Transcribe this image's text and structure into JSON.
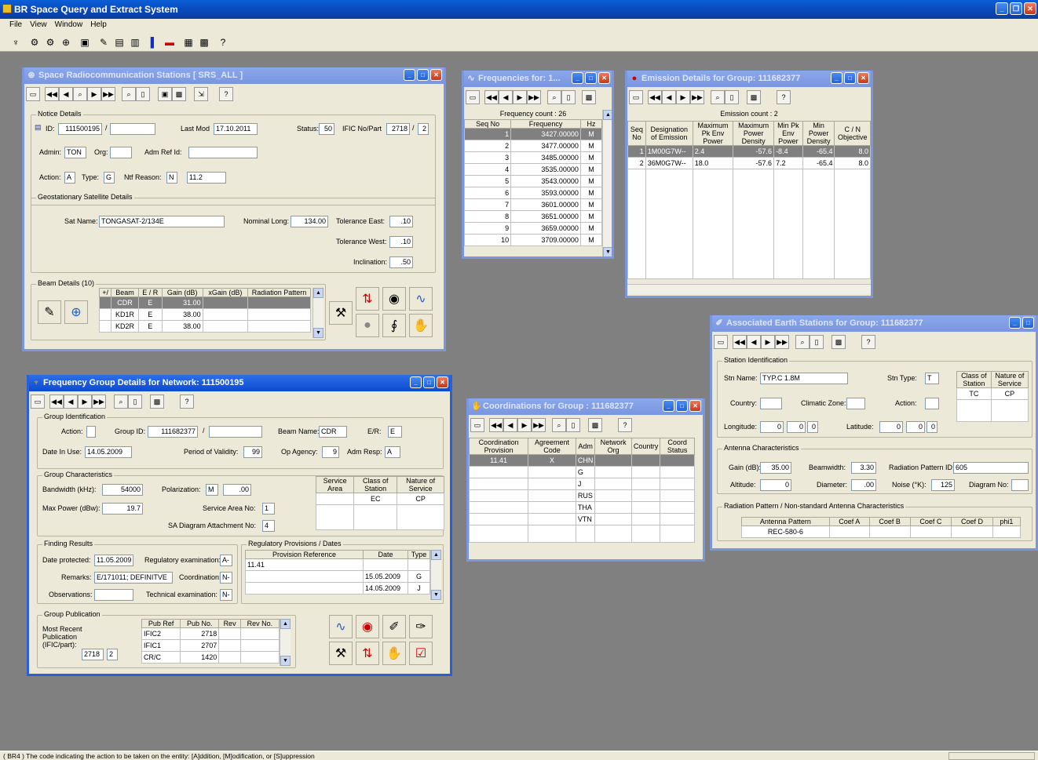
{
  "app": {
    "title": "BR Space Query and Extract System",
    "menus": [
      "File",
      "View",
      "Window",
      "Help"
    ]
  },
  "status": {
    "text": "( BR4 )  The code indicating the action to be taken on the entity: [A]ddition, [M]odification, or [S]uppression"
  },
  "srs": {
    "title": "Space Radiocommunication Stations    [ SRS_ALL ]",
    "notice": {
      "legend": "Notice Details",
      "id_label": "ID:",
      "id": "111500195",
      "lastmod_label": "Last Mod",
      "lastmod": "17.10.2011",
      "status_label": "Status:",
      "status": "50",
      "ific_label": "IFIC No/Part",
      "ific_no": "2718",
      "ific_part": "2",
      "admin_label": "Admin:",
      "admin": "TON",
      "org_label": "Org:",
      "admref_label": "Adm Ref Id:",
      "action_label": "Action:",
      "action": "A",
      "type_label": "Type:",
      "type": "G",
      "ntf_label": "Ntf Reason:",
      "ntf": "N",
      "ntf_val": "11.2"
    },
    "geo": {
      "legend": "Geostationary Satellite Details",
      "sat_label": "Sat Name:",
      "sat": "TONGASAT-2/134E",
      "long_label": "Nominal Long:",
      "long": "134.00",
      "tol_e_label": "Tolerance East:",
      "tol_e": ".10",
      "tol_w_label": "Tolerance West:",
      "tol_w": ".10",
      "incl_label": "Inclination:",
      "incl": ".50"
    },
    "beams": {
      "legend": "Beam Details (10)",
      "headers": [
        "+/",
        "Beam",
        "E / R",
        "Gain (dB)",
        "xGain (dB)",
        "Radiation Pattern"
      ],
      "rows": [
        [
          "",
          "CDR",
          "E",
          "31.00",
          "",
          ""
        ],
        [
          "",
          "KD1R",
          "E",
          "38.00",
          "",
          ""
        ],
        [
          "",
          "KD2R",
          "E",
          "38.00",
          "",
          ""
        ]
      ]
    }
  },
  "freqs": {
    "title": "Frequencies for: 1...",
    "count": "Frequency count : 26",
    "headers": [
      "Seq No",
      "Frequency",
      "Hz"
    ],
    "rows": [
      [
        "1",
        "3427.00000",
        "M"
      ],
      [
        "2",
        "3477.00000",
        "M"
      ],
      [
        "3",
        "3485.00000",
        "M"
      ],
      [
        "4",
        "3535.00000",
        "M"
      ],
      [
        "5",
        "3543.00000",
        "M"
      ],
      [
        "6",
        "3593.00000",
        "M"
      ],
      [
        "7",
        "3601.00000",
        "M"
      ],
      [
        "8",
        "3651.00000",
        "M"
      ],
      [
        "9",
        "3659.00000",
        "M"
      ],
      [
        "10",
        "3709.00000",
        "M"
      ]
    ]
  },
  "emis": {
    "title": "Emission Details for Group: 111682377",
    "count": "Emission count : 2",
    "headers": [
      "Seq No",
      "Designation of Emission",
      "Maximum Pk Env Power",
      "Maximum Power Density",
      "Min Pk Env Power",
      "Min Power Density",
      "C / N Objective"
    ],
    "rows": [
      [
        "1",
        "1M00G7W--",
        "2.4",
        "-57.6",
        "-8.4",
        "-65.4",
        "8.0"
      ],
      [
        "2",
        "36M0G7W--",
        "18.0",
        "-57.6",
        "7.2",
        "-65.4",
        "8.0"
      ]
    ]
  },
  "fgd": {
    "title": "Frequency Group Details for Network: 111500195",
    "gid": {
      "legend": "Group Identification",
      "action_label": "Action:",
      "gid_label": "Group ID:",
      "gid": "111682377",
      "beam_label": "Beam Name:",
      "beam": "CDR",
      "er_label": "E/R:",
      "er": "E",
      "date_label": "Date In Use:",
      "date": "14.05.2009",
      "period_label": "Period of Validity:",
      "period": "99",
      "op_label": "Op Agency:",
      "op": "9",
      "adm_label": "Adm Resp:",
      "adm": "A"
    },
    "gc": {
      "legend": "Group Characteristics",
      "bw_label": "Bandwidth (kHz):",
      "bw": "54000",
      "pol_label": "Polarization:",
      "pol": "M",
      "pol2": ".00",
      "mp_label": "Max Power (dBw):",
      "mp": "19.7",
      "sa_label": "Service Area No:",
      "sa": "1",
      "sad_label": "SA Diagram Attachment No:",
      "sad": "4",
      "cols": [
        "Service Area",
        "Class of Station",
        "Nature of Service"
      ],
      "row": [
        "",
        "EC",
        "CP"
      ]
    },
    "fr": {
      "legend": "Finding Results",
      "dp_label": "Date protected:",
      "dp": "11.05.2009",
      "reg_label": "Regulatory examination:",
      "reg": "A-",
      "rem_label": "Remarks:",
      "rem": "E/171011; DEFINITVE",
      "coord_label": "Coordination:",
      "coord": "N-",
      "obs_label": "Observations:",
      "tech_label": "Technical examination:",
      "tech": "N-"
    },
    "rp": {
      "legend": "Regulatory Provisions / Dates",
      "headers": [
        "Provision Reference",
        "Date",
        "Type"
      ],
      "rows": [
        [
          "11.41",
          "",
          ""
        ],
        [
          "",
          "15.05.2009",
          "G"
        ],
        [
          "",
          "14.05.2009",
          "J"
        ]
      ]
    },
    "gp": {
      "legend": "Group Publication",
      "most": "Most Recent Publication (IFIC/part):",
      "ific": "2718",
      "part": "2",
      "headers": [
        "Pub Ref",
        "Pub No.",
        "Rev",
        "Rev No."
      ],
      "rows": [
        [
          "IFIC2",
          "2718",
          "",
          ""
        ],
        [
          "IFIC1",
          "2707",
          "",
          ""
        ],
        [
          "CR/C",
          "1420",
          "",
          ""
        ]
      ]
    }
  },
  "coord": {
    "title": "Coordinations for Group : 111682377",
    "headers": [
      "Coordination Provision",
      "Agreement Code",
      "Adm",
      "Network Org",
      "Country",
      "Coord Status"
    ],
    "rows": [
      [
        "11.41",
        "X",
        "CHN",
        "",
        "",
        ""
      ],
      [
        "",
        "",
        "G",
        "",
        "",
        ""
      ],
      [
        "",
        "",
        "J",
        "",
        "",
        ""
      ],
      [
        "",
        "",
        "RUS",
        "",
        "",
        ""
      ],
      [
        "",
        "",
        "THA",
        "",
        "",
        ""
      ],
      [
        "",
        "",
        "VTN",
        "",
        "",
        ""
      ]
    ]
  },
  "assoc": {
    "title": "Associated Earth Stations for Group: 111682377",
    "si": {
      "legend": "Station Identification",
      "name_label": "Stn Name:",
      "name": "TYP.C 1.8M",
      "type_label": "Stn Type:",
      "type": "T",
      "country_label": "Country:",
      "climatic_label": "Climatic Zone:",
      "action_label": "Action:",
      "lon_label": "Longitude:",
      "lon": [
        "0",
        "0",
        "0"
      ],
      "lat_label": "Latitude:",
      "lat": [
        "0",
        "0",
        "0"
      ],
      "cols": [
        "Class of Station",
        "Nature of Service"
      ],
      "row": [
        "TC",
        "CP"
      ]
    },
    "ac": {
      "legend": "Antenna Characteristics",
      "gain_label": "Gain (dB):",
      "gain": "35.00",
      "bw_label": "Beamwidth:",
      "bw": "3.30",
      "rp_label": "Radiation Pattern ID:",
      "rp": "605",
      "alt_label": "Altitude:",
      "alt": "0",
      "dia_label": "Diameter:",
      "dia": ".00",
      "noise_label": "Noise (°K):",
      "noise": "125",
      "diag_label": "Diagram No:"
    },
    "rp": {
      "legend": "Radiation Pattern / Non-standard Antenna Characteristics",
      "headers": [
        "Antenna Pattern",
        "Coef A",
        "Coef B",
        "Coef C",
        "Coef D",
        "phi1"
      ],
      "row": [
        "REC-580-6",
        "",
        "",
        "",
        "",
        ""
      ]
    }
  }
}
